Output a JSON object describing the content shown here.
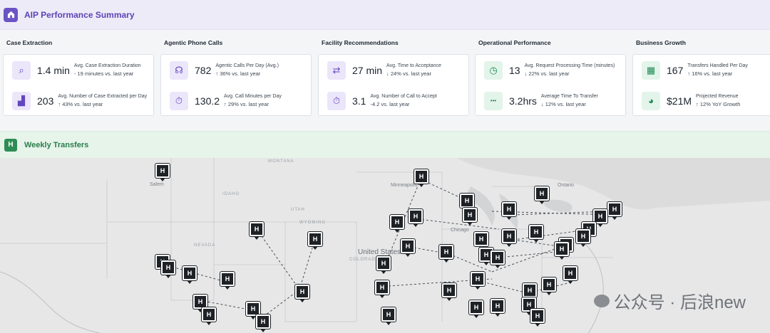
{
  "header": {
    "title": "AIP Performance Summary"
  },
  "sections": [
    {
      "title": "Case Extraction",
      "metrics": [
        {
          "icon": "magnify-icon",
          "glyph": "⌕",
          "value": "1.4 min",
          "label": "Avg. Case Extraction Duration",
          "delta": "- 19 minutes vs. last year"
        },
        {
          "icon": "chart-up-icon",
          "glyph": "▟",
          "value": "203",
          "label": "Avg. Number of Case Extracted per Day",
          "delta": "↑ 43% vs. last year"
        }
      ]
    },
    {
      "title": "Agentic Phone Calls",
      "metrics": [
        {
          "icon": "headset-icon",
          "glyph": "☊",
          "value": "782",
          "label": "Agentic Calls Per Day (Avg.)",
          "delta": "↑ 36% vs. last year"
        },
        {
          "icon": "timer-icon",
          "glyph": "⏱",
          "value": "130.2",
          "label": "Avg. Call Minutes per Day",
          "delta": "↑ 29% vs. last year"
        }
      ]
    },
    {
      "title": "Facility Recommendations",
      "metrics": [
        {
          "icon": "transfer-icon",
          "glyph": "⇄",
          "value": "27 min",
          "label": "Avg. Time to Acceptance",
          "delta": "↓ 24% vs. last year"
        },
        {
          "icon": "timer-icon",
          "glyph": "⏱",
          "value": "3.1",
          "label": "Avg. Number of Call to Accept",
          "delta": "-4.2 vs. last year"
        }
      ]
    },
    {
      "title": "Operational Performance",
      "metrics": [
        {
          "icon": "clock-icon",
          "glyph": "◷",
          "value": "13",
          "label": "Avg. Request Processing Time (minutes)",
          "delta": "↓ 22% vs. last year"
        },
        {
          "icon": "dots-icon",
          "glyph": "•••",
          "value": "3.2hrs",
          "label": "Average Time To Transfer",
          "delta": "↓ 12% vs. last year"
        }
      ]
    },
    {
      "title": "Business Growth",
      "metrics": [
        {
          "icon": "calendar-icon",
          "glyph": "▦",
          "value": "167",
          "label": "Transfers Handled Per Day",
          "delta": "↑ 16% vs. last year"
        },
        {
          "icon": "piggy-bank-icon",
          "glyph": "◕",
          "value": "$21M",
          "label": "Projected Revenue",
          "delta": "↑ 12% YoY Growth"
        }
      ]
    }
  ],
  "weekly": {
    "title": "Weekly Transfers",
    "icon_letter": "H"
  },
  "map": {
    "marker_letter": "H",
    "labels": {
      "montana": "MONTANA",
      "idaho": "IDAHO",
      "wyoming": "WYOMING",
      "nevada": "NEVADA",
      "utah": "UTAH",
      "colorado": "COLORADO",
      "united_states": "United States",
      "minneapolis": "Minneapolis",
      "chicago": "Chicago",
      "ontario": "Ontario",
      "salem": "Salem"
    }
  },
  "watermark": {
    "text": "公众号 · 后浪new"
  }
}
